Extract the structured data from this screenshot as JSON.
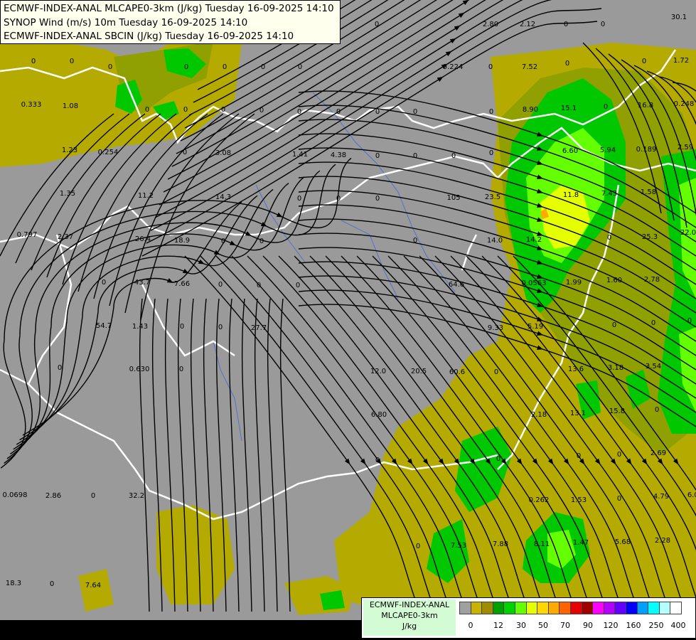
{
  "header": {
    "line1": "ECMWF-INDEX-ANAL MLCAPE0-3km (J/kg) Tuesday 16-09-2025 14:10",
    "line2": "SYNOP Wind (m/s) 10m Tuesday 16-09-2025 14:10",
    "line3": "ECMWF-INDEX-ANAL SBCIN (J/kg) Tuesday 16-09-2025 14:10"
  },
  "legend": {
    "title": "ECMWF-INDEX-ANAL",
    "variable": "MLCAPE0-3km",
    "unit": "J/kg",
    "tick_labels": [
      "0",
      "12",
      "30",
      "50",
      "70",
      "90",
      "120",
      "160",
      "250",
      "400"
    ],
    "colors": [
      "#a0a0a0",
      "#c8b400",
      "#a08c00",
      "#00a000",
      "#00d200",
      "#64ff00",
      "#e6ff00",
      "#ffd700",
      "#ffaa00",
      "#ff6400",
      "#e60000",
      "#a00000",
      "#ff00ff",
      "#b400ff",
      "#6400ff",
      "#0000ff",
      "#00a0ff",
      "#00ffff",
      "#b4ffff",
      "#ffffff"
    ]
  },
  "map_colors": {
    "background": "#9a9a9a",
    "cape_low": "#b4aa00",
    "cape_mid": "#8fa000",
    "cape_green": "#00c800",
    "cape_lime": "#64ff00",
    "cape_yellow": "#e6ff00",
    "border": "#ffffff",
    "river": "#5570cc",
    "streamline": "#000000"
  },
  "sbcin_values": [
    "0",
    "2.80",
    "2.12",
    "0",
    "0",
    "30.1",
    "1.72",
    "0",
    "0",
    "0",
    "0",
    "0",
    "0",
    "0",
    "0.224",
    "0",
    "7.52",
    "0",
    "0",
    "0.248",
    "0.333",
    "1.08",
    "0",
    "0",
    "0",
    "0",
    "0",
    "0",
    "0",
    "0",
    "0",
    "8.90",
    "15.1",
    "0",
    "16.8",
    "2.59",
    "1.23",
    "0.254",
    "0",
    "3.08",
    "1.41",
    "4.38",
    "0",
    "0",
    "0",
    "0",
    "6.60",
    "5.94",
    "0.189",
    "1.35",
    "11.2",
    "14.3",
    "0",
    "0",
    "0",
    "105",
    "23.5",
    "11.8",
    "7.43",
    "1.58",
    "0.797",
    "2.37",
    "26.4",
    "18.9",
    "0",
    "0",
    "0",
    "14.0",
    "14.2",
    "0",
    "25.3",
    "22.0",
    "0",
    "43.7",
    "7.66",
    "0",
    "0",
    "0",
    "64.6",
    "0.0563",
    "1.99",
    "1.60",
    "2.78",
    "54.7",
    "1.43",
    "0",
    "0",
    "27.7",
    "9.33",
    "5.19",
    "0",
    "0",
    "0",
    "0",
    "0.630",
    "0",
    "12.0",
    "20.5",
    "60.6",
    "0",
    "13.6",
    "3.18",
    "3.54",
    "6.80",
    "2.18",
    "13.1",
    "15.8",
    "0",
    "0",
    "0",
    "0",
    "0",
    "2.69",
    "0.0698",
    "2.86",
    "0",
    "32.2",
    "0.262",
    "1.53",
    "0",
    "4.79",
    "6.09",
    "0",
    "7.53",
    "7.88",
    "8.11",
    "1.47",
    "5.68",
    "2.28",
    "18.3",
    "0",
    "7.64"
  ]
}
